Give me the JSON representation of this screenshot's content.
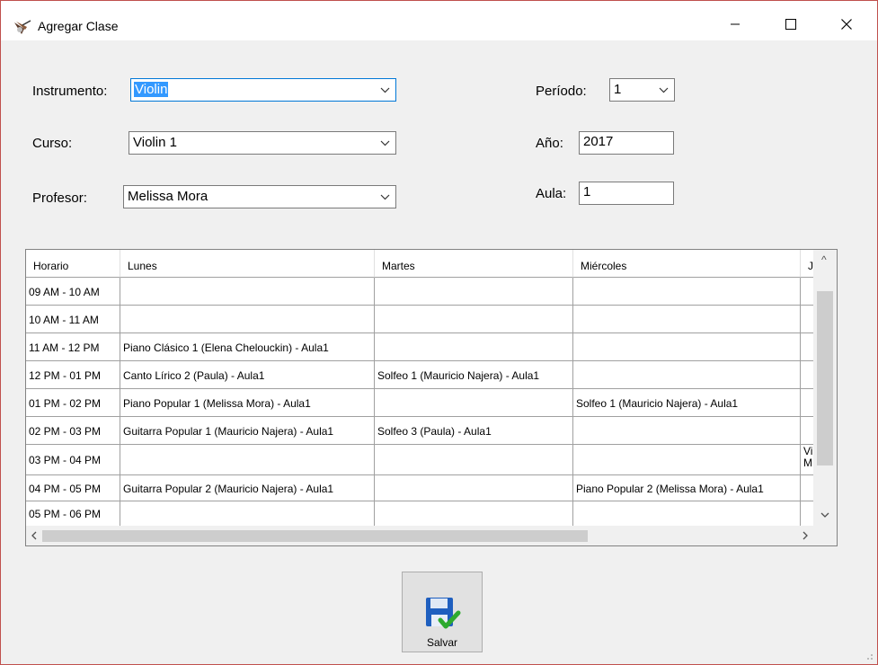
{
  "window": {
    "title": "Agregar Clase"
  },
  "form": {
    "instrumento": {
      "label": "Instrumento:",
      "value": "Violin"
    },
    "curso": {
      "label": "Curso:",
      "value": "Violin 1"
    },
    "profesor": {
      "label": "Profesor:",
      "value": "Melissa Mora"
    },
    "periodo": {
      "label": "Período:",
      "value": "1"
    },
    "anio": {
      "label": "Año:",
      "value": "2017"
    },
    "aula": {
      "label": "Aula:",
      "value": "1"
    }
  },
  "schedule": {
    "columns": [
      "Horario",
      "Lunes",
      "Martes",
      "Miércoles",
      "J"
    ],
    "rows": [
      [
        "09 AM - 10 AM",
        "",
        "",
        "",
        ""
      ],
      [
        "10 AM - 11 AM",
        "",
        "",
        "",
        ""
      ],
      [
        "11 AM - 12 PM",
        "Piano Clásico 1 (Elena Chelouckin) - Aula1",
        "",
        "",
        ""
      ],
      [
        "12 PM - 01 PM",
        "Canto Lírico 2 (Paula) - Aula1",
        "Solfeo 1 (Mauricio Najera) - Aula1",
        "",
        ""
      ],
      [
        "01 PM - 02 PM",
        "Piano Popular 1 (Melissa Mora) - Aula1",
        "",
        "Solfeo 1 (Mauricio Najera) - Aula1",
        ""
      ],
      [
        "02 PM - 03 PM",
        "Guitarra Popular 1 (Mauricio Najera) - Aula1",
        "Solfeo 3 (Paula) - Aula1",
        "",
        ""
      ],
      [
        "03 PM - 04 PM",
        "",
        "",
        "",
        "Vi M"
      ],
      [
        "04 PM - 05 PM",
        "Guitarra Popular 2 (Mauricio Najera) - Aula1",
        "",
        "Piano Popular 2 (Melissa Mora) - Aula1",
        ""
      ],
      [
        "05 PM - 06 PM",
        "",
        "",
        "",
        ""
      ]
    ]
  },
  "buttons": {
    "save_label": "Salvar"
  },
  "icons": {
    "app": "guitar-app-icon",
    "save": "floppy-disk-check-icon",
    "minimize": "minimize-icon",
    "maximize": "maximize-icon",
    "close": "close-icon"
  },
  "colors": {
    "selection": "#3399ff",
    "focus_border": "#0078d7",
    "window_border": "#c0504d"
  }
}
